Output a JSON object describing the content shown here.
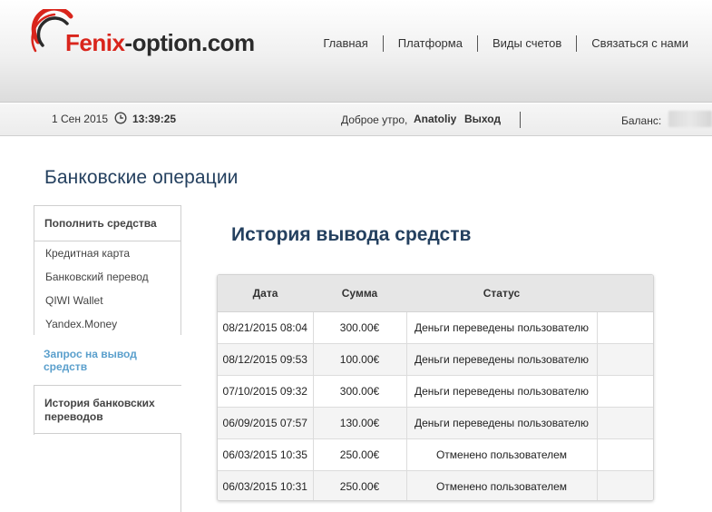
{
  "header": {
    "logo": {
      "part1": "Fenix",
      "part2": "-option.com"
    },
    "nav": [
      "Главная",
      "Платформа",
      "Виды счетов",
      "Связаться с нами"
    ]
  },
  "infobar": {
    "date": "1 Сен 2015",
    "time": "13:39:25",
    "greeting": "Доброе утро,",
    "username": "Anatoliy",
    "logout": "Выход",
    "balance_label": "Баланс:"
  },
  "page_title": "Банковские операции",
  "sidebar": {
    "deposit_header": "Пополнить средства",
    "deposit_items": [
      "Кредитная карта",
      "Банковский перевод",
      "QIWI Wallet",
      "Yandex.Money"
    ],
    "withdraw_request": [
      "Запрос на вывод",
      "средств"
    ],
    "transfer_history": [
      "История банковских",
      "переводов"
    ]
  },
  "section_title": "История вывода средств",
  "table": {
    "headers": [
      "Дата",
      "Сумма",
      "Статус",
      ""
    ],
    "rows": [
      [
        "08/21/2015 08:04",
        "300.00€",
        "Деньги переведены пользователю",
        ""
      ],
      [
        "08/12/2015 09:53",
        "100.00€",
        "Деньги переведены пользователю",
        ""
      ],
      [
        "07/10/2015 09:32",
        "300.00€",
        "Деньги переведены пользователю",
        ""
      ],
      [
        "06/09/2015 07:57",
        "130.00€",
        "Деньги переведены пользователю",
        ""
      ],
      [
        "06/03/2015 10:35",
        "250.00€",
        "Отменено пользователем",
        ""
      ],
      [
        "06/03/2015 10:31",
        "250.00€",
        "Отменено пользователем",
        ""
      ]
    ]
  },
  "colors": {
    "brand_red": "#d9251c",
    "title_blue": "#24405f",
    "active_link": "#5a9fcc"
  },
  "icons": {
    "clock": "clock-icon",
    "logo_mark": "logo-swoosh-icon"
  }
}
